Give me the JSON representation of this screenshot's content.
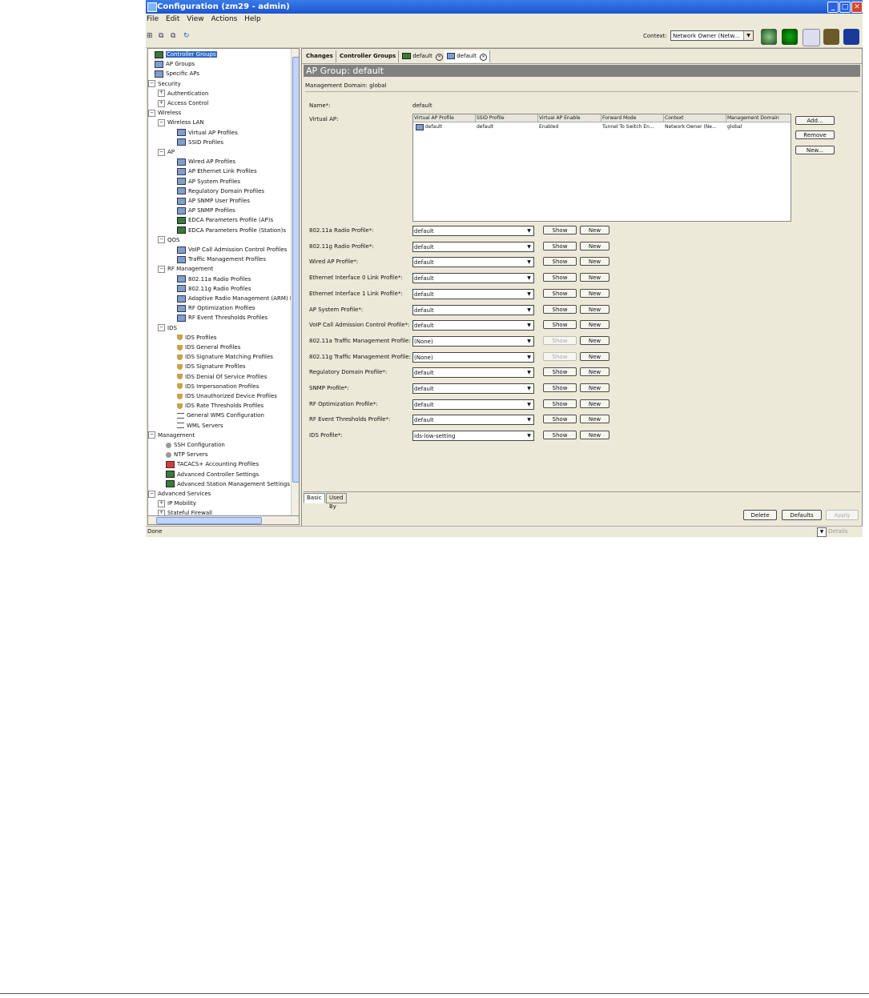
{
  "window": {
    "title": "Configuration (zm29 - admin)"
  },
  "menu": [
    "File",
    "Edit",
    "View",
    "Actions",
    "Help"
  ],
  "toolbar": {
    "context_label": "Context:",
    "context_value": "Network Owner (Netw..."
  },
  "tree": [
    {
      "label": "Controller Groups",
      "level": 0,
      "icon": "controller-icon",
      "selected": true
    },
    {
      "label": "AP Groups",
      "level": 0,
      "icon": "ap-icon"
    },
    {
      "label": "Specific APs",
      "level": 0,
      "icon": "ap-icon"
    },
    {
      "label": "Security",
      "level": 0,
      "expander": "⊟"
    },
    {
      "label": "Authentication",
      "level": 1,
      "expander": "⊞"
    },
    {
      "label": "Access Control",
      "level": 1,
      "expander": "⊞"
    },
    {
      "label": "Wireless",
      "level": 0,
      "expander": "⊟"
    },
    {
      "label": "Wireless LAN",
      "level": 1,
      "expander": "⊟"
    },
    {
      "label": "Virtual AP Profiles",
      "level": 2,
      "icon": "ap-icon"
    },
    {
      "label": "SSID Profiles",
      "level": 2,
      "icon": "ap-icon"
    },
    {
      "label": "AP",
      "level": 1,
      "expander": "⊟"
    },
    {
      "label": "Wired AP Profiles",
      "level": 2,
      "icon": "ap-icon"
    },
    {
      "label": "AP Ethernet Link Profiles",
      "level": 2,
      "icon": "ap-icon"
    },
    {
      "label": "AP System Profiles",
      "level": 2,
      "icon": "ap-icon"
    },
    {
      "label": "Regulatory Domain Profiles",
      "level": 2,
      "icon": "ap-icon"
    },
    {
      "label": "AP SNMP User Profiles",
      "level": 2,
      "icon": "ap-icon"
    },
    {
      "label": "AP SNMP Profiles",
      "level": 2,
      "icon": "ap-icon"
    },
    {
      "label": "EDCA Parameters Profile (AP)s",
      "level": 2,
      "icon": "controller-icon"
    },
    {
      "label": "EDCA Parameters Profile (Station)s",
      "level": 2,
      "icon": "controller-icon"
    },
    {
      "label": "QOS",
      "level": 1,
      "expander": "⊟"
    },
    {
      "label": "VoIP Call Admission Control Profiles",
      "level": 2,
      "icon": "ap-icon"
    },
    {
      "label": "Traffic Management Profiles",
      "level": 2,
      "icon": "ap-icon"
    },
    {
      "label": "RF Management",
      "level": 1,
      "expander": "⊟"
    },
    {
      "label": "802.11a Radio Profiles",
      "level": 2,
      "icon": "ap-icon"
    },
    {
      "label": "802.11g Radio Profiles",
      "level": 2,
      "icon": "ap-icon"
    },
    {
      "label": "Adaptive Radio Management (ARM) P",
      "level": 2,
      "icon": "ap-icon"
    },
    {
      "label": "RF Optimization Profiles",
      "level": 2,
      "icon": "ap-icon"
    },
    {
      "label": "RF Event Thresholds Profiles",
      "level": 2,
      "icon": "ap-icon"
    },
    {
      "label": "IDS",
      "level": 1,
      "expander": "⊟"
    },
    {
      "label": "IDS Profiles",
      "level": 2,
      "icon": "shield-icon"
    },
    {
      "label": "IDS General Profiles",
      "level": 2,
      "icon": "shield-icon"
    },
    {
      "label": "IDS Signature Matching Profiles",
      "level": 2,
      "icon": "shield-icon"
    },
    {
      "label": "IDS Signature Profiles",
      "level": 2,
      "icon": "shield-icon"
    },
    {
      "label": "IDS Denial Of Service Profiles",
      "level": 2,
      "icon": "shield-icon"
    },
    {
      "label": "IDS Impersonation Profiles",
      "level": 2,
      "icon": "shield-icon"
    },
    {
      "label": "IDS Unauthorized Device Profiles",
      "level": 2,
      "icon": "shield-icon"
    },
    {
      "label": "IDS Rate Thresholds Profiles",
      "level": 2,
      "icon": "shield-icon"
    },
    {
      "label": "General WMS Configuration",
      "level": 2,
      "icon": "list-icon"
    },
    {
      "label": "WML Servers",
      "level": 2,
      "icon": "list-icon"
    },
    {
      "label": "Management",
      "level": 0,
      "expander": "⊟"
    },
    {
      "label": "SSH Configuration",
      "level": 1,
      "icon": "key-icon"
    },
    {
      "label": "NTP Servers",
      "level": 1,
      "icon": "key-icon"
    },
    {
      "label": "TACACS+ Accounting Profiles",
      "level": 1,
      "icon": "server-icon"
    },
    {
      "label": "Advanced Controller Settings",
      "level": 1,
      "icon": "controller-icon"
    },
    {
      "label": "Advanced Station Management Settings",
      "level": 1,
      "icon": "controller-icon"
    },
    {
      "label": "Advanced Services",
      "level": 0,
      "expander": "⊟"
    },
    {
      "label": "IP Mobility",
      "level": 1,
      "expander": "⊞"
    },
    {
      "label": "Stateful Firewall",
      "level": 1,
      "expander": "⊞"
    }
  ],
  "tabs": {
    "changes": "Changes",
    "controller_groups": "Controller Groups",
    "default1": "default",
    "default2": "default"
  },
  "header": {
    "title": "AP Group: default",
    "mgmt_domain": "Management Domain:  global"
  },
  "form": {
    "name_label": "Name*:",
    "name_value": "default",
    "vap_label": "Virtual AP:",
    "vap_columns": [
      "Virtual AP Profile",
      "SSID Profile",
      "Virtual AP Enable",
      "Forward Mode",
      "Context",
      "Management Domain"
    ],
    "vap_row": [
      "default",
      "default",
      "Enabled",
      "Tunnel To Switch En...",
      "Network Owner (Ne...",
      "global"
    ],
    "buttons": {
      "add": "Add...",
      "remove": "Remove",
      "new": "New..."
    },
    "show_label": "Show",
    "new_label": "New",
    "profiles": [
      {
        "label": "802.11a Radio Profile*:",
        "value": "default",
        "show_enabled": true
      },
      {
        "label": "802.11g Radio Profile*:",
        "value": "default",
        "show_enabled": true
      },
      {
        "label": "Wired AP Profile*:",
        "value": "default",
        "show_enabled": true
      },
      {
        "label": "Ethernet Interface 0 Link Profile*:",
        "value": "default",
        "show_enabled": true
      },
      {
        "label": "Ethernet Interface 1 Link Profile*:",
        "value": "default",
        "show_enabled": true
      },
      {
        "label": "AP System Profile*:",
        "value": "default",
        "show_enabled": true
      },
      {
        "label": "VoIP Call Admission Control Profile*:",
        "value": "default",
        "show_enabled": true
      },
      {
        "label": "802.11a Traffic Management Profile:",
        "value": "(None)",
        "show_enabled": false
      },
      {
        "label": "802.11g Traffic Management Profile:",
        "value": "(None)",
        "show_enabled": false
      },
      {
        "label": "Regulatory Domain Profile*:",
        "value": "default",
        "show_enabled": true
      },
      {
        "label": "SNMP Profile*:",
        "value": "default",
        "show_enabled": true
      },
      {
        "label": "RF Optimization Profile*:",
        "value": "default",
        "show_enabled": true
      },
      {
        "label": "RF Event Thresholds Profile*:",
        "value": "default",
        "show_enabled": true
      },
      {
        "label": "IDS Profile*:",
        "value": "ids-low-setting",
        "show_enabled": true
      }
    ]
  },
  "bottom_tabs": {
    "basic": "Basic",
    "used_by": "Used By"
  },
  "actions": {
    "delete": "Delete",
    "defaults": "Defaults",
    "apply": "Apply"
  },
  "status": {
    "text": "Done",
    "details": "Details"
  }
}
